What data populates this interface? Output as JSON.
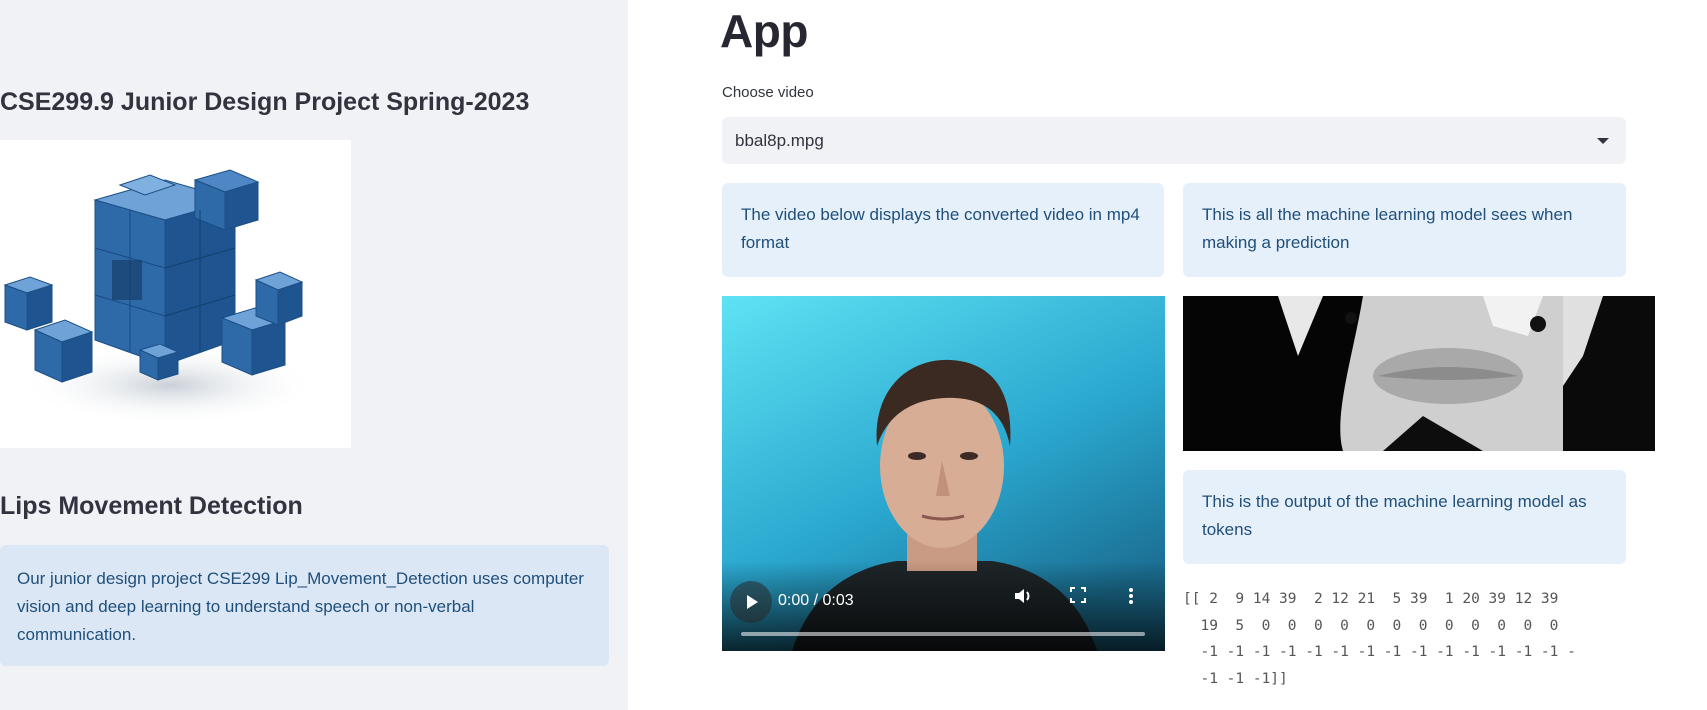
{
  "sidebar": {
    "title": "CSE299.9 Junior Design Project Spring-2023",
    "image_icon": "blue-cubes-logo",
    "heading": "Lips Movement Detection",
    "info": "Our junior design project CSE299 Lip_Movement_Detection uses computer vision and deep learning to understand speech or non-verbal communication."
  },
  "main": {
    "title": "App",
    "select_label": "Choose video",
    "selected_video": "bbal8p.mpg",
    "info_video": "The video below displays the converted video in mp4 format",
    "info_model_sees": "This is all the machine learning model sees when making a prediction",
    "info_tokens": "This is the output of the machine learning model as tokens",
    "tokens_output": "[[ 2  9 14 39  2 12 21  5 39  1 20 39 12 39\n  19  5  0  0  0  0  0  0  0  0  0  0  0  0\n  -1 -1 -1 -1 -1 -1 -1 -1 -1 -1 -1 -1 -1 -1 -\n  -1 -1 -1]]"
  },
  "video_player": {
    "time_display": "0:00 / 0:03",
    "progress": 0,
    "icons": [
      "play-icon",
      "volume-icon",
      "fullscreen-icon",
      "more-options-icon"
    ]
  },
  "colors": {
    "sidebar_bg": "#f0f2f6",
    "info_bg": "#e6f0fb",
    "info_text": "#1f4f7a",
    "video_bg": "#3bb6d6"
  }
}
